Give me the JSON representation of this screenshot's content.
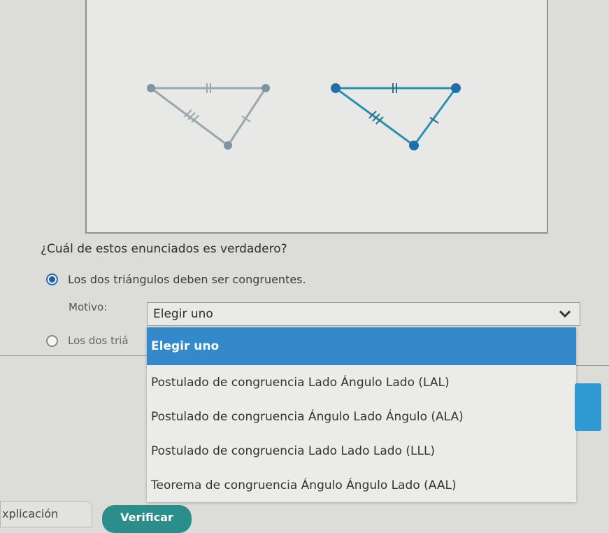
{
  "question": "¿Cuál de estos enunciados es verdadero?",
  "options": [
    {
      "label": "Los dos triángulos deben ser congruentes.",
      "selected": true
    },
    {
      "label": "Los dos triá",
      "selected": false
    }
  ],
  "motivo": {
    "label": "Motivo:",
    "selected": "Elegir uno",
    "icon": "chevron-down-icon",
    "choices": [
      "Elegir uno",
      "Postulado de congruencia Lado Ángulo Lado (LAL)",
      "Postulado de congruencia Ángulo Lado Ángulo (ALA)",
      "Postulado de congruencia Lado Lado Lado (LLL)",
      "Teorema de congruencia Ángulo Ángulo Lado (AAL)"
    ]
  },
  "footer": {
    "explanation_tab": "xplicación",
    "verify_button": "Verificar"
  },
  "colors": {
    "accent": "#3389c9",
    "triangle_right": "#2d8fb0",
    "triangle_left": "#8a9da8",
    "verify": "#2a8f8a"
  }
}
